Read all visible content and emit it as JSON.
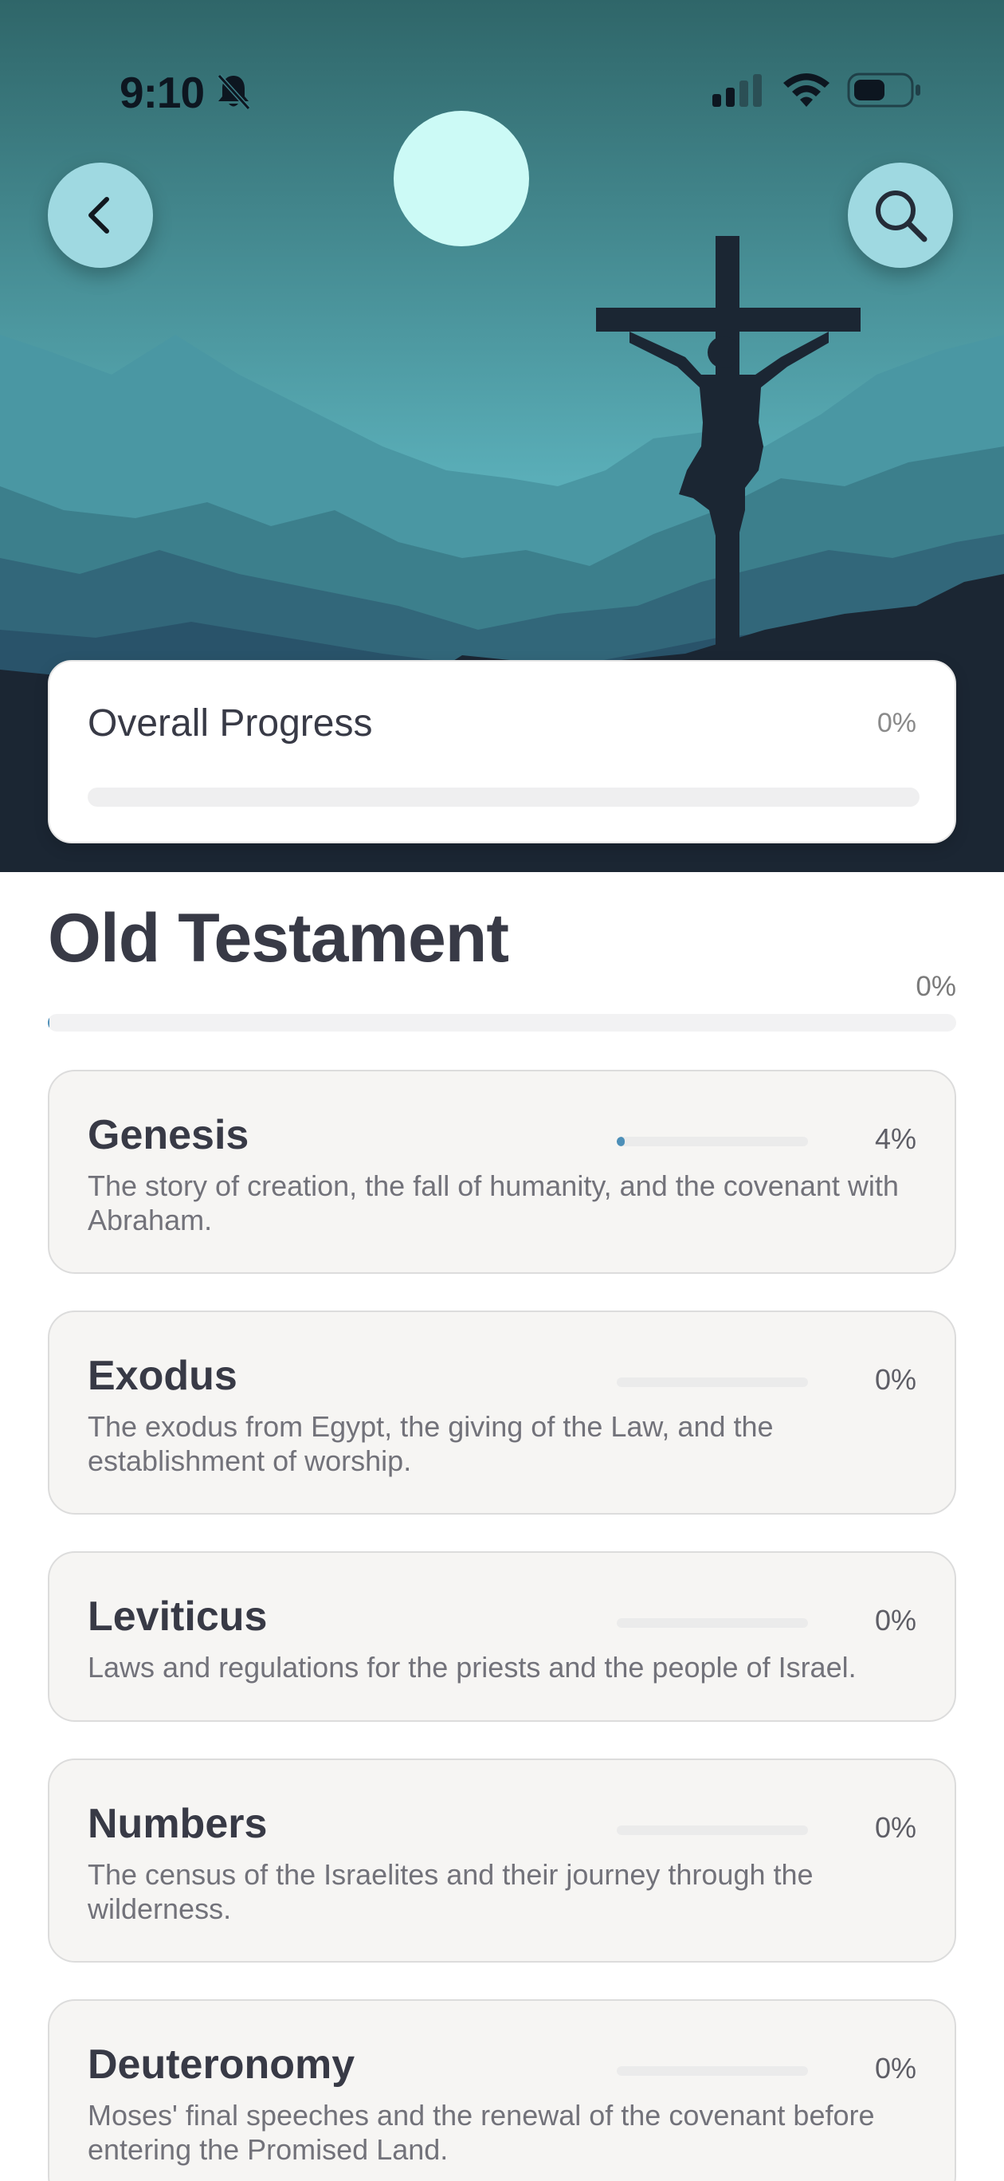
{
  "status_bar": {
    "time": "9:10"
  },
  "icons": {
    "back": "chevron-left-icon",
    "search": "search-icon",
    "bell": "bell-slash-icon",
    "signal": "cellular-signal-icon",
    "wifi": "wifi-icon",
    "battery": "battery-icon"
  },
  "colors": {
    "accent": "#4d8fb8",
    "button_bg": "#9fd9e1",
    "moon": "#ccfaf6",
    "hero_sky_top": "#2f6669",
    "hero_sky_mid": "#5aaeb8",
    "hero_dark": "#1b2633"
  },
  "overall": {
    "title": "Overall Progress",
    "percent_label": "0%",
    "progress": 0
  },
  "section": {
    "title": "Old Testament",
    "percent_label": "0%",
    "progress": 0.002
  },
  "books": [
    {
      "name": "Genesis",
      "percent_label": "4%",
      "progress": 0.04,
      "description": "The story of creation, the fall of humanity, and the covenant with Abraham."
    },
    {
      "name": "Exodus",
      "percent_label": "0%",
      "progress": 0,
      "description": "The exodus from Egypt, the giving of the Law, and the establishment of worship."
    },
    {
      "name": "Leviticus",
      "percent_label": "0%",
      "progress": 0,
      "description": "Laws and regulations for the priests and the people of Israel."
    },
    {
      "name": "Numbers",
      "percent_label": "0%",
      "progress": 0,
      "description": "The census of the Israelites and their journey through the wilderness."
    },
    {
      "name": "Deuteronomy",
      "percent_label": "0%",
      "progress": 0,
      "description": "Moses' final speeches and the renewal of the covenant before entering the Promised Land."
    }
  ]
}
